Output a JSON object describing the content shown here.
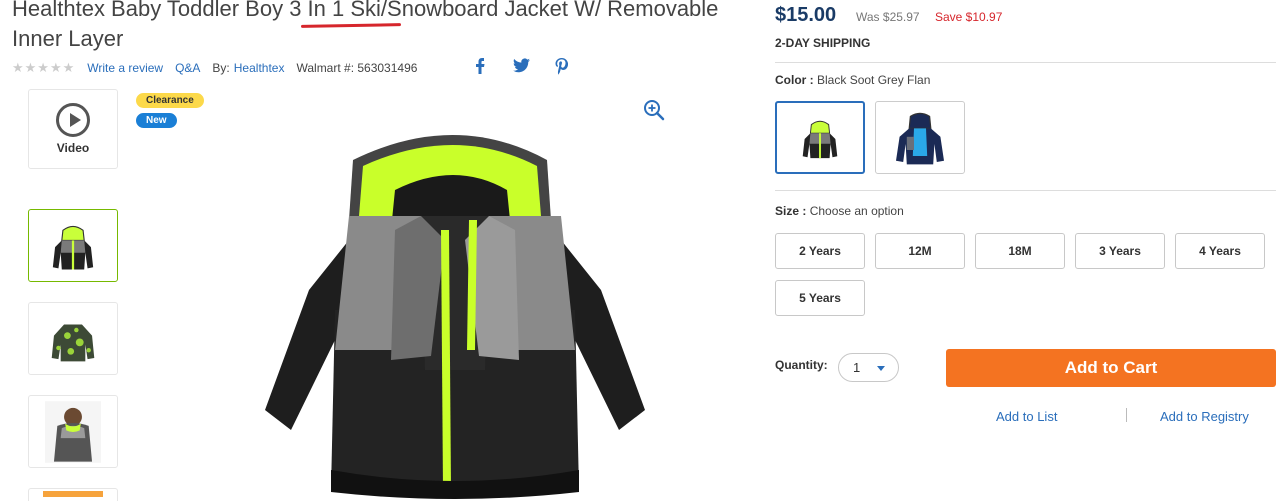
{
  "product": {
    "title_before": "Healthtex Baby Toddler Boy ",
    "title_highlight": "3 In 1 Ski",
    "title_after": "/Snowboard Jacket W/ Removable Inner Layer",
    "stars": "★★★★★",
    "write_review": "Write a review",
    "qa": "Q&A",
    "by_label": "By:",
    "brand": "Healthtex",
    "walmart_id": "Walmart #: 563031496"
  },
  "social": {
    "facebook": "f",
    "twitter": "twitter",
    "pinterest": "P"
  },
  "gallery": {
    "video_label": "Video",
    "badges": {
      "clearance": "Clearance",
      "new": "New"
    },
    "selected_thumbnail": 1
  },
  "pricing": {
    "price": "$15.00",
    "was": "Was $25.97",
    "save": "Save $10.97",
    "shipping": "2-DAY SHIPPING"
  },
  "color": {
    "label": "Color :",
    "value": "Black Soot Grey Flan"
  },
  "size": {
    "label": "Size :",
    "value": "Choose an option",
    "options": [
      "2 Years",
      "12M",
      "18M",
      "3 Years",
      "4 Years",
      "5 Years"
    ]
  },
  "quantity": {
    "label": "Quantity:",
    "value": "1"
  },
  "actions": {
    "add_to_cart": "Add to Cart",
    "add_to_list": "Add to List",
    "add_to_registry": "Add to Registry"
  },
  "colors": {
    "link": "#2a6ebb",
    "price": "#1a3b66",
    "save": "#d6262c",
    "cart_button": "#f47321",
    "highlight_underline": "#d6262c",
    "active_thumb_border": "#76b900"
  }
}
